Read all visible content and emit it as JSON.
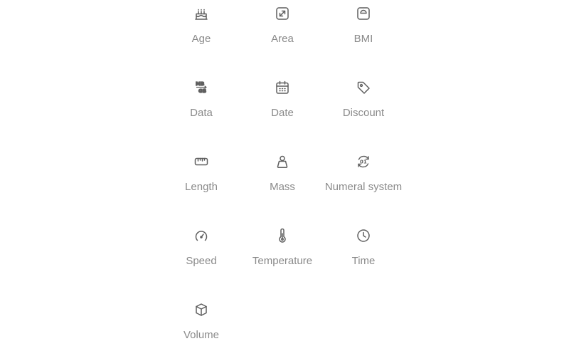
{
  "converters": [
    {
      "label": "Age",
      "icon": "cake-icon"
    },
    {
      "label": "Area",
      "icon": "expand-arrows-icon"
    },
    {
      "label": "BMI",
      "icon": "scale-icon"
    },
    {
      "label": "Data",
      "icon": "mb-gb-icon",
      "icon_text_top": "MB",
      "icon_text_bottom": "GB"
    },
    {
      "label": "Date",
      "icon": "calendar-icon"
    },
    {
      "label": "Discount",
      "icon": "tag-icon"
    },
    {
      "label": "Length",
      "icon": "ruler-icon"
    },
    {
      "label": "Mass",
      "icon": "weight-icon"
    },
    {
      "label": "Numeral system",
      "icon": "numeral-cycle-icon",
      "icon_text": "01"
    },
    {
      "label": "Speed",
      "icon": "speedometer-icon"
    },
    {
      "label": "Temperature",
      "icon": "thermometer-icon"
    },
    {
      "label": "Time",
      "icon": "clock-icon"
    },
    {
      "label": "Volume",
      "icon": "cube-icon"
    }
  ],
  "colors": {
    "icon": "#5f5f5f",
    "label": "#8a8a8a",
    "background": "#ffffff"
  }
}
